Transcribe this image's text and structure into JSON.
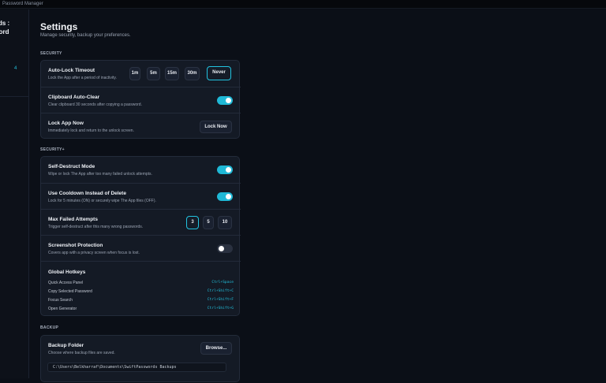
{
  "window": {
    "title": "Password Manager"
  },
  "sidebar": {
    "title_line1": "ords :",
    "title_line2": "sword",
    "count": "4"
  },
  "page": {
    "title": "Settings",
    "subtitle": "Manage security, backup your preferences."
  },
  "sections": {
    "security": "SECURITY",
    "security_plus": "SECURITY+",
    "backup": "BACKUP"
  },
  "security": {
    "auto_lock": {
      "title": "Auto-Lock Timeout",
      "desc": "Lock the App after a period of inactivity.",
      "options": [
        "1m",
        "5m",
        "15m",
        "30m",
        "Never"
      ],
      "selected": "Never"
    },
    "clipboard": {
      "title": "Clipboard Auto-Clear",
      "desc": "Clear clipboard 30 seconds after copying a password.",
      "enabled": true
    },
    "lock_now": {
      "title": "Lock App Now",
      "desc": "Immediately lock and return to the unlock screen.",
      "button": "Lock Now"
    }
  },
  "security_plus": {
    "self_destruct": {
      "title": "Self-Destruct Mode",
      "desc": "Wipe or lock The App after too many failed unlock attempts.",
      "enabled": true
    },
    "cooldown": {
      "title": "Use Cooldown Instead of Delete",
      "desc": "Lock for 5 minutes (ON) or securely wipe The App files (OFF).",
      "enabled": true
    },
    "max_failed": {
      "title": "Max Failed Attempts",
      "desc": "Trigger self-destruct after this many wrong passwords.",
      "options": [
        "3",
        "5",
        "10"
      ],
      "selected": "3"
    },
    "screenshot": {
      "title": "Screenshot Protection",
      "desc": "Covers app with a privacy screen when focus is lost.",
      "enabled": false
    },
    "hotkeys": {
      "title": "Global Hotkeys",
      "items": [
        {
          "label": "Quick Access Panel",
          "key": "Ctrl+Space"
        },
        {
          "label": "Copy Selected Password",
          "key": "Ctrl+Shift+C"
        },
        {
          "label": "Focus Search",
          "key": "Ctrl+Shift+F"
        },
        {
          "label": "Open Generator",
          "key": "Ctrl+Shift+G"
        }
      ]
    }
  },
  "backup": {
    "folder": {
      "title": "Backup Folder",
      "desc": "Choose where backup files are saved.",
      "button": "Browse...",
      "path": "C:\\Users\\Belkharraf\\Documents\\SwiftPasswords Backups"
    }
  },
  "colors": {
    "accent": "#1fb8d6",
    "background": "#0b0f17",
    "card": "#141a25"
  }
}
